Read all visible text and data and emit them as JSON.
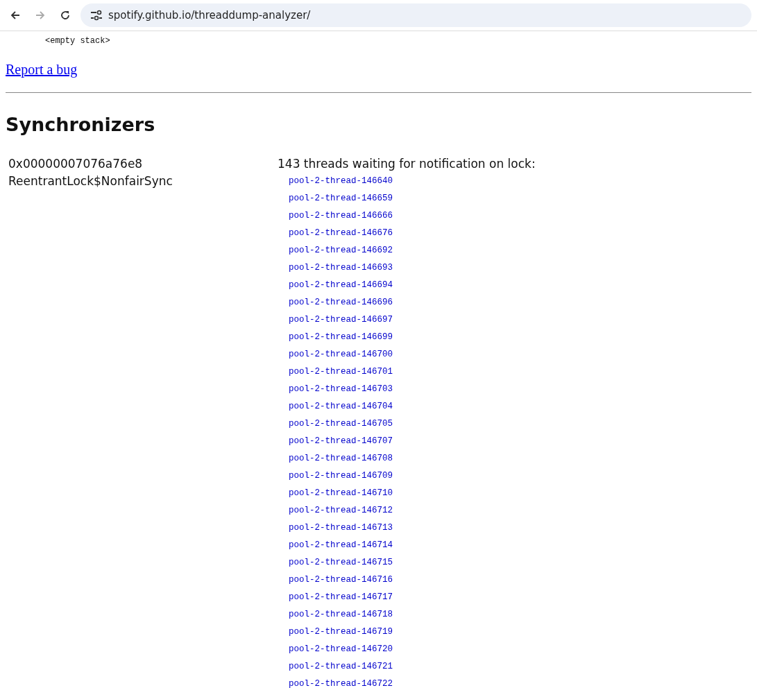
{
  "browser": {
    "url": "spotify.github.io/threaddump-analyzer/"
  },
  "top_text": "<empty stack>",
  "report_link": "Report a bug",
  "heading": "Synchronizers",
  "lock": {
    "address": "0x00000007076a76e8",
    "class_name": "ReentrantLock$NonfairSync",
    "waiting_title": "143 threads waiting for notification on lock:",
    "threads": [
      "pool-2-thread-146640",
      "pool-2-thread-146659",
      "pool-2-thread-146666",
      "pool-2-thread-146676",
      "pool-2-thread-146692",
      "pool-2-thread-146693",
      "pool-2-thread-146694",
      "pool-2-thread-146696",
      "pool-2-thread-146697",
      "pool-2-thread-146699",
      "pool-2-thread-146700",
      "pool-2-thread-146701",
      "pool-2-thread-146703",
      "pool-2-thread-146704",
      "pool-2-thread-146705",
      "pool-2-thread-146707",
      "pool-2-thread-146708",
      "pool-2-thread-146709",
      "pool-2-thread-146710",
      "pool-2-thread-146712",
      "pool-2-thread-146713",
      "pool-2-thread-146714",
      "pool-2-thread-146715",
      "pool-2-thread-146716",
      "pool-2-thread-146717",
      "pool-2-thread-146718",
      "pool-2-thread-146719",
      "pool-2-thread-146720",
      "pool-2-thread-146721",
      "pool-2-thread-146722"
    ]
  }
}
